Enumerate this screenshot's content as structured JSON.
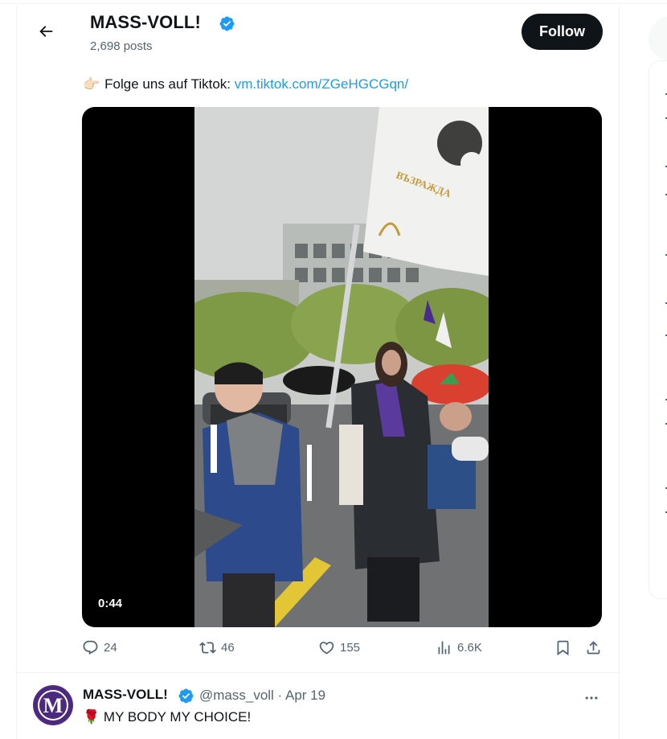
{
  "profile": {
    "name": "MASS-VOLL!",
    "posts": "2,698 posts",
    "follow_label": "Follow"
  },
  "tweet": {
    "text_prefix": "Folge uns auf Tiktok: ",
    "link": "vm.tiktok.com/ZGeHGCGqn/",
    "emoji": "👉🏻",
    "video_duration": "0:44",
    "flag_text": "ВЪЗРАЖДА"
  },
  "actions": {
    "replies": "24",
    "reposts": "46",
    "likes": "155",
    "views": "6.6K"
  },
  "reply": {
    "name": "MASS-VOLL!",
    "handle_time": "@mass_voll · Apr 19",
    "emoji": "🌹",
    "text": "MY BODY MY CHOICE!",
    "avatar_letter": "M"
  },
  "colors": {
    "link": "#1d9bf0",
    "verified": "#1d9bf0",
    "secondary_text": "#536471",
    "follow_bg": "#0f1419"
  }
}
